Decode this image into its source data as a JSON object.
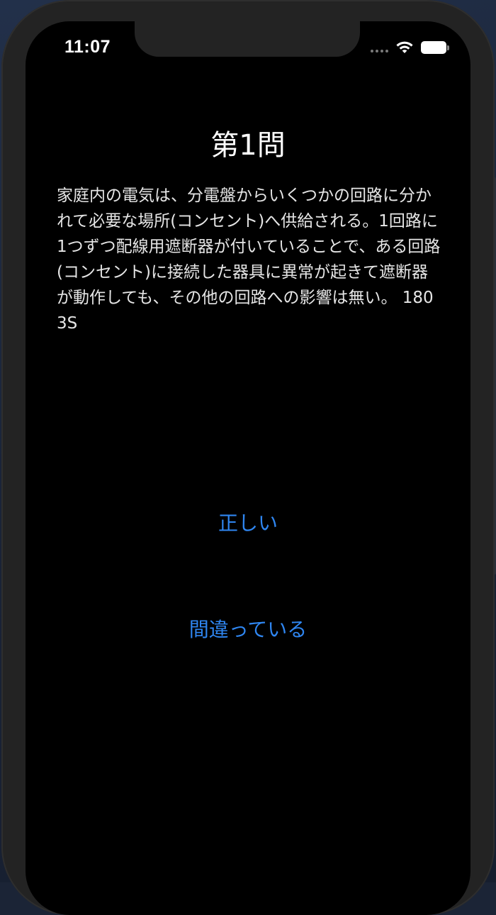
{
  "status_bar": {
    "time": "11:07",
    "icons": [
      "signal-dots-icon",
      "wifi-icon",
      "battery-icon"
    ]
  },
  "question": {
    "title": "第1問",
    "text": "家庭内の電気は、分電盤からいくつかの回路に分かれて必要な場所(コンセント)へ供給される。1回路に1つずつ配線用遮断器が付いていることで、ある回路(コンセント)に接続した器具に異常が起きて遮断器が動作しても、その他の回路への影響は無い。 1803S"
  },
  "answers": {
    "correct_label": "正しい",
    "wrong_label": "間違っている"
  },
  "colors": {
    "background": "#000000",
    "text": "#ffffff",
    "button_tint": "#2f86f1"
  }
}
